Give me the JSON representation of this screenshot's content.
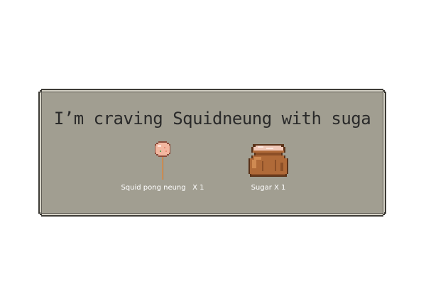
{
  "dialog": {
    "message": "I’m craving Squidneung with suga"
  },
  "items": [
    {
      "icon": "squid-lollipop-icon",
      "label": "Squid pong neung   X 1"
    },
    {
      "icon": "sugar-sack-icon",
      "label": "Sugar X 1"
    }
  ],
  "colors": {
    "panel": "#a19e91",
    "border_dark": "#3e3c37",
    "border_light": "#d6d3c7",
    "text": "#2a2a2a",
    "label": "#ffffff"
  }
}
